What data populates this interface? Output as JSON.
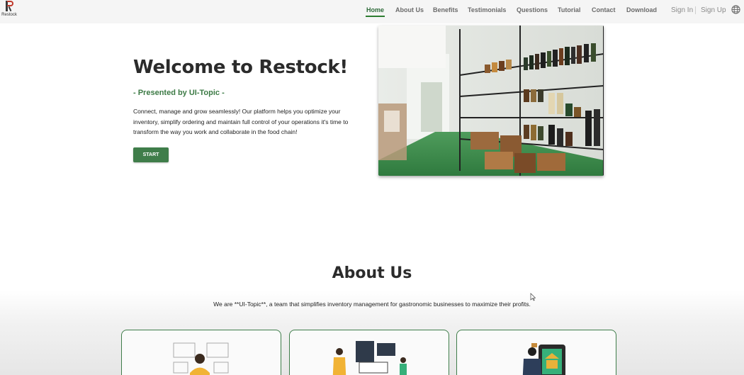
{
  "brand": {
    "logo_text": "Restock"
  },
  "nav": {
    "items": [
      {
        "label": "Home",
        "active": true
      },
      {
        "label": "About Us"
      },
      {
        "label": "Benefits"
      },
      {
        "label": "Testimonials"
      },
      {
        "label": "Questions"
      },
      {
        "label": "Tutorial"
      },
      {
        "label": "Contact"
      },
      {
        "label": "Download"
      }
    ],
    "sign_in": "Sign In",
    "sign_up": "Sign Up",
    "language_icon": "globe-icon"
  },
  "hero": {
    "title": "Welcome to Restock!",
    "subtitle": "- Presented by UI-Topic -",
    "description": "Connect, manage and grow seamlessly! Our platform helps you optimize your inventory, simplify ordering and maintain full control of your operations it's time to transform the way you work and collaborate in the food chain!",
    "start_label": "START"
  },
  "about": {
    "title": "About Us",
    "description": "We are **UI-Topic**, a team that simplifies inventory management for gastronomic businesses to maximize their profits."
  },
  "colors": {
    "accent": "#3f7d4a",
    "active_nav": "#2e6b3a",
    "underline": "#2e7d32"
  }
}
